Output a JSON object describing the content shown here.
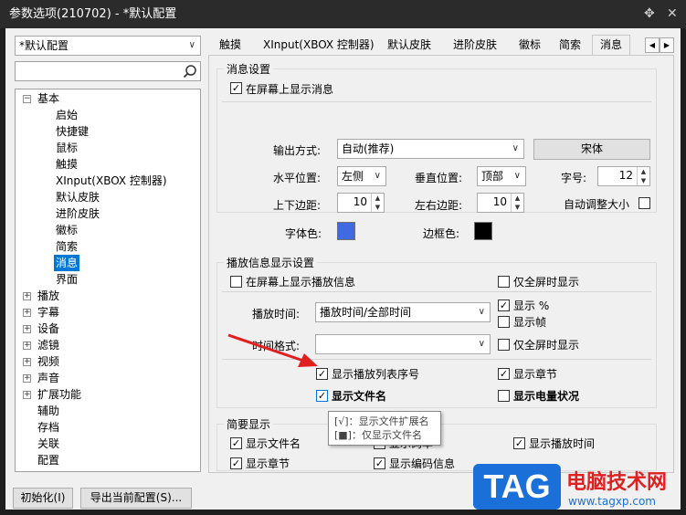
{
  "window": {
    "title": "参数选项(210702) - *默认配置",
    "pin_glyph": "✥",
    "close_glyph": "✕"
  },
  "profile": {
    "selected": "*默认配置"
  },
  "search": {
    "placeholder": ""
  },
  "tree": {
    "root": "基本",
    "children": [
      "启始",
      "快捷键",
      "鼠标",
      "触摸",
      "XInput(XBOX 控制器)",
      "默认皮肤",
      "进阶皮肤",
      "徽标",
      "简索",
      "消息",
      "界面"
    ],
    "groups": [
      "播放",
      "字幕",
      "设备",
      "滤镜",
      "视频",
      "声音",
      "扩展功能"
    ],
    "leaves": [
      "辅助",
      "存档",
      "关联",
      "配置"
    ]
  },
  "tabs": [
    "触摸",
    "XInput(XBOX 控制器)",
    "默认皮肤",
    "进阶皮肤",
    "徽标",
    "简索",
    "消息"
  ],
  "tab_nav": {
    "prev": "◀",
    "next": "▶"
  },
  "msg_settings": {
    "title": "消息设置",
    "show_on_screen": "在屏幕上显示消息",
    "output_label": "输出方式:",
    "output_value": "自动(推荐)",
    "font_button": "宋体",
    "hpos_label": "水平位置:",
    "hpos_value": "左侧",
    "vpos_label": "垂直位置:",
    "vpos_value": "顶部",
    "fontsize_label": "字号:",
    "fontsize_value": "12",
    "vmargin_label": "上下边距:",
    "vmargin_value": "10",
    "hmargin_label": "左右边距:",
    "hmargin_value": "10",
    "autosize_label": "自动调整大小",
    "fontcolor_label": "字体色:",
    "bordercolor_label": "边框色:"
  },
  "play_info": {
    "title": "播放信息显示设置",
    "show_play_info": "在屏幕上显示播放信息",
    "fullscreen_only_1": "仅全屏时显示",
    "playtime_label": "播放时间:",
    "playtime_value": "播放时间/全部时间",
    "show_percent": "显示 %",
    "show_frame": "显示帧",
    "timeformat_label": "时间格式:",
    "timeformat_value": "",
    "fullscreen_only_2": "仅全屏时显示",
    "show_playlist_no": "显示播放列表序号",
    "show_chapter": "显示章节",
    "show_filename": "显示文件名",
    "show_battery": "显示电量状况"
  },
  "tooltip": {
    "line1": "[√]：显示文件扩展名",
    "line2": "[■]：仅显示文件名"
  },
  "brief": {
    "title": "简要显示",
    "show_filename": "显示文件名",
    "show_bitrate": "显示码率",
    "show_playtime": "显示播放时间",
    "show_chapter": "显示章节",
    "show_codec": "显示编码信息"
  },
  "footer": {
    "init_button": "初始化(I)",
    "export_button": "导出当前配置(S)..."
  },
  "watermark": {
    "logo": "TAG",
    "title": "电脑技术网",
    "url": "www.tagxp.com"
  },
  "colors": {
    "font_color": "#4169e1",
    "border_color": "#000000",
    "accent": "#0078d7",
    "arrow": "#e02020"
  }
}
